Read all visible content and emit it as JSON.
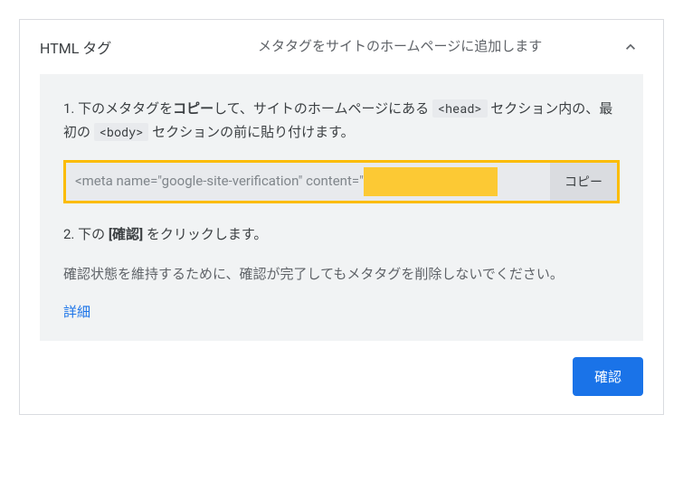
{
  "header": {
    "title": "HTML タグ",
    "description": "メタタグをサイトのホームページに追加します"
  },
  "step1": {
    "prefix": "1. 下のメタタグを",
    "bold": "コピー",
    "mid1": "して、サイトのホームページにある",
    "code1": "<head>",
    "mid2": "セクション内の、最初の",
    "code2": "<body>",
    "suffix": "セクションの前に貼り付けます。"
  },
  "codebox": {
    "text": "<meta name=\"google-site-verification\" content=\"",
    "copy_label": "コピー"
  },
  "step2": {
    "prefix": "2. 下の ",
    "bold": "[確認]",
    "suffix": " をクリックします。"
  },
  "note": "確認状態を維持するために、確認が完了してもメタタグを削除しないでください。",
  "details_link": "詳細",
  "verify_button": "確認"
}
